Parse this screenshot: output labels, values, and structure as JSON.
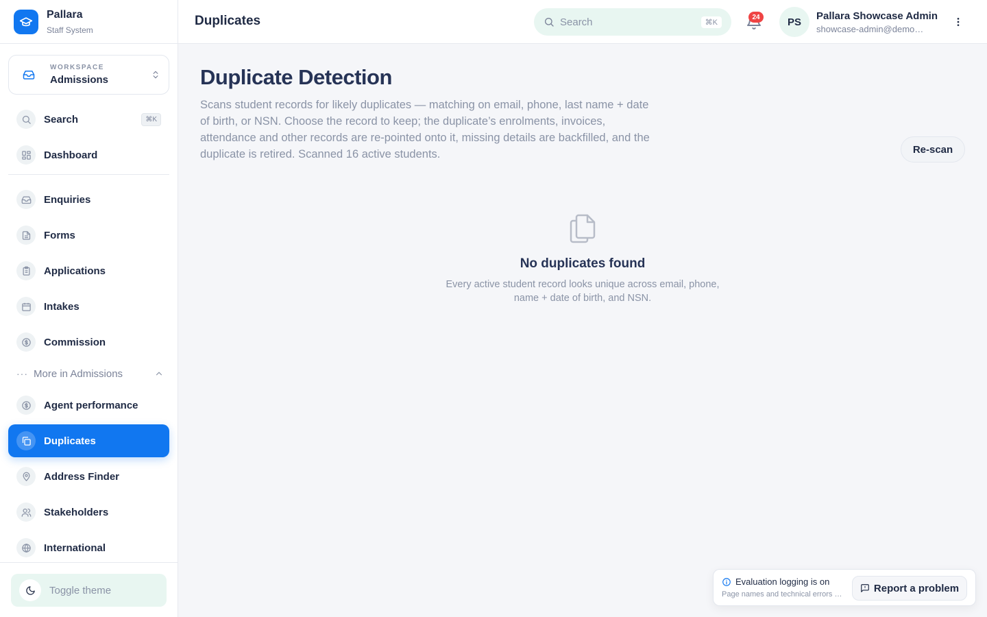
{
  "brand": {
    "name": "Pallara",
    "subtitle": "Staff System"
  },
  "workspace": {
    "label": "WORKSPACE",
    "value": "Admissions"
  },
  "sidebar": {
    "search": {
      "label": "Search",
      "shortcut": "⌘K"
    },
    "items": [
      {
        "label": "Dashboard",
        "icon": "grid-icon"
      },
      {
        "label": "Enquiries",
        "icon": "inbox-icon"
      },
      {
        "label": "Forms",
        "icon": "document-icon"
      },
      {
        "label": "Applications",
        "icon": "clipboard-icon"
      },
      {
        "label": "Intakes",
        "icon": "calendar-icon"
      },
      {
        "label": "Commission",
        "icon": "dollar-circle-icon"
      }
    ],
    "more_label": "More in Admissions",
    "more_items": [
      {
        "label": "Agent performance",
        "icon": "dollar-circle-icon"
      },
      {
        "label": "Duplicates",
        "icon": "copy-icon",
        "active": true
      },
      {
        "label": "Address Finder",
        "icon": "map-pin-icon"
      },
      {
        "label": "Stakeholders",
        "icon": "users-icon"
      },
      {
        "label": "International",
        "icon": "globe-icon"
      }
    ],
    "toggle_theme": "Toggle theme"
  },
  "header": {
    "title": "Duplicates",
    "search_placeholder": "Search",
    "search_shortcut": "⌘K",
    "notification_count": "24",
    "user_initials": "PS",
    "user_name": "Pallara Showcase Admin",
    "user_email": "showcase-admin@demo.pallara.com"
  },
  "main": {
    "title": "Duplicate Detection",
    "description": "Scans student records for likely duplicates — matching on email, phone, last name + date of birth, or NSN. Choose the record to keep; the duplicate’s enrolments, invoices, attendance and other records are re-pointed onto it, missing details are backfilled, and the duplicate is retired. Scanned 16 active students.",
    "rescan_label": "Re-scan",
    "empty_title": "No duplicates found",
    "empty_description": "Every active student record looks unique across email, phone, name + date of birth, and NSN."
  },
  "eval": {
    "title": "Evaluation logging is on",
    "subtitle": "Page names and technical errors are logged",
    "report_label": "Report a problem"
  },
  "colors": {
    "accent": "#1177f0",
    "mint": "#e8f6f1",
    "badge": "#ef4444"
  }
}
